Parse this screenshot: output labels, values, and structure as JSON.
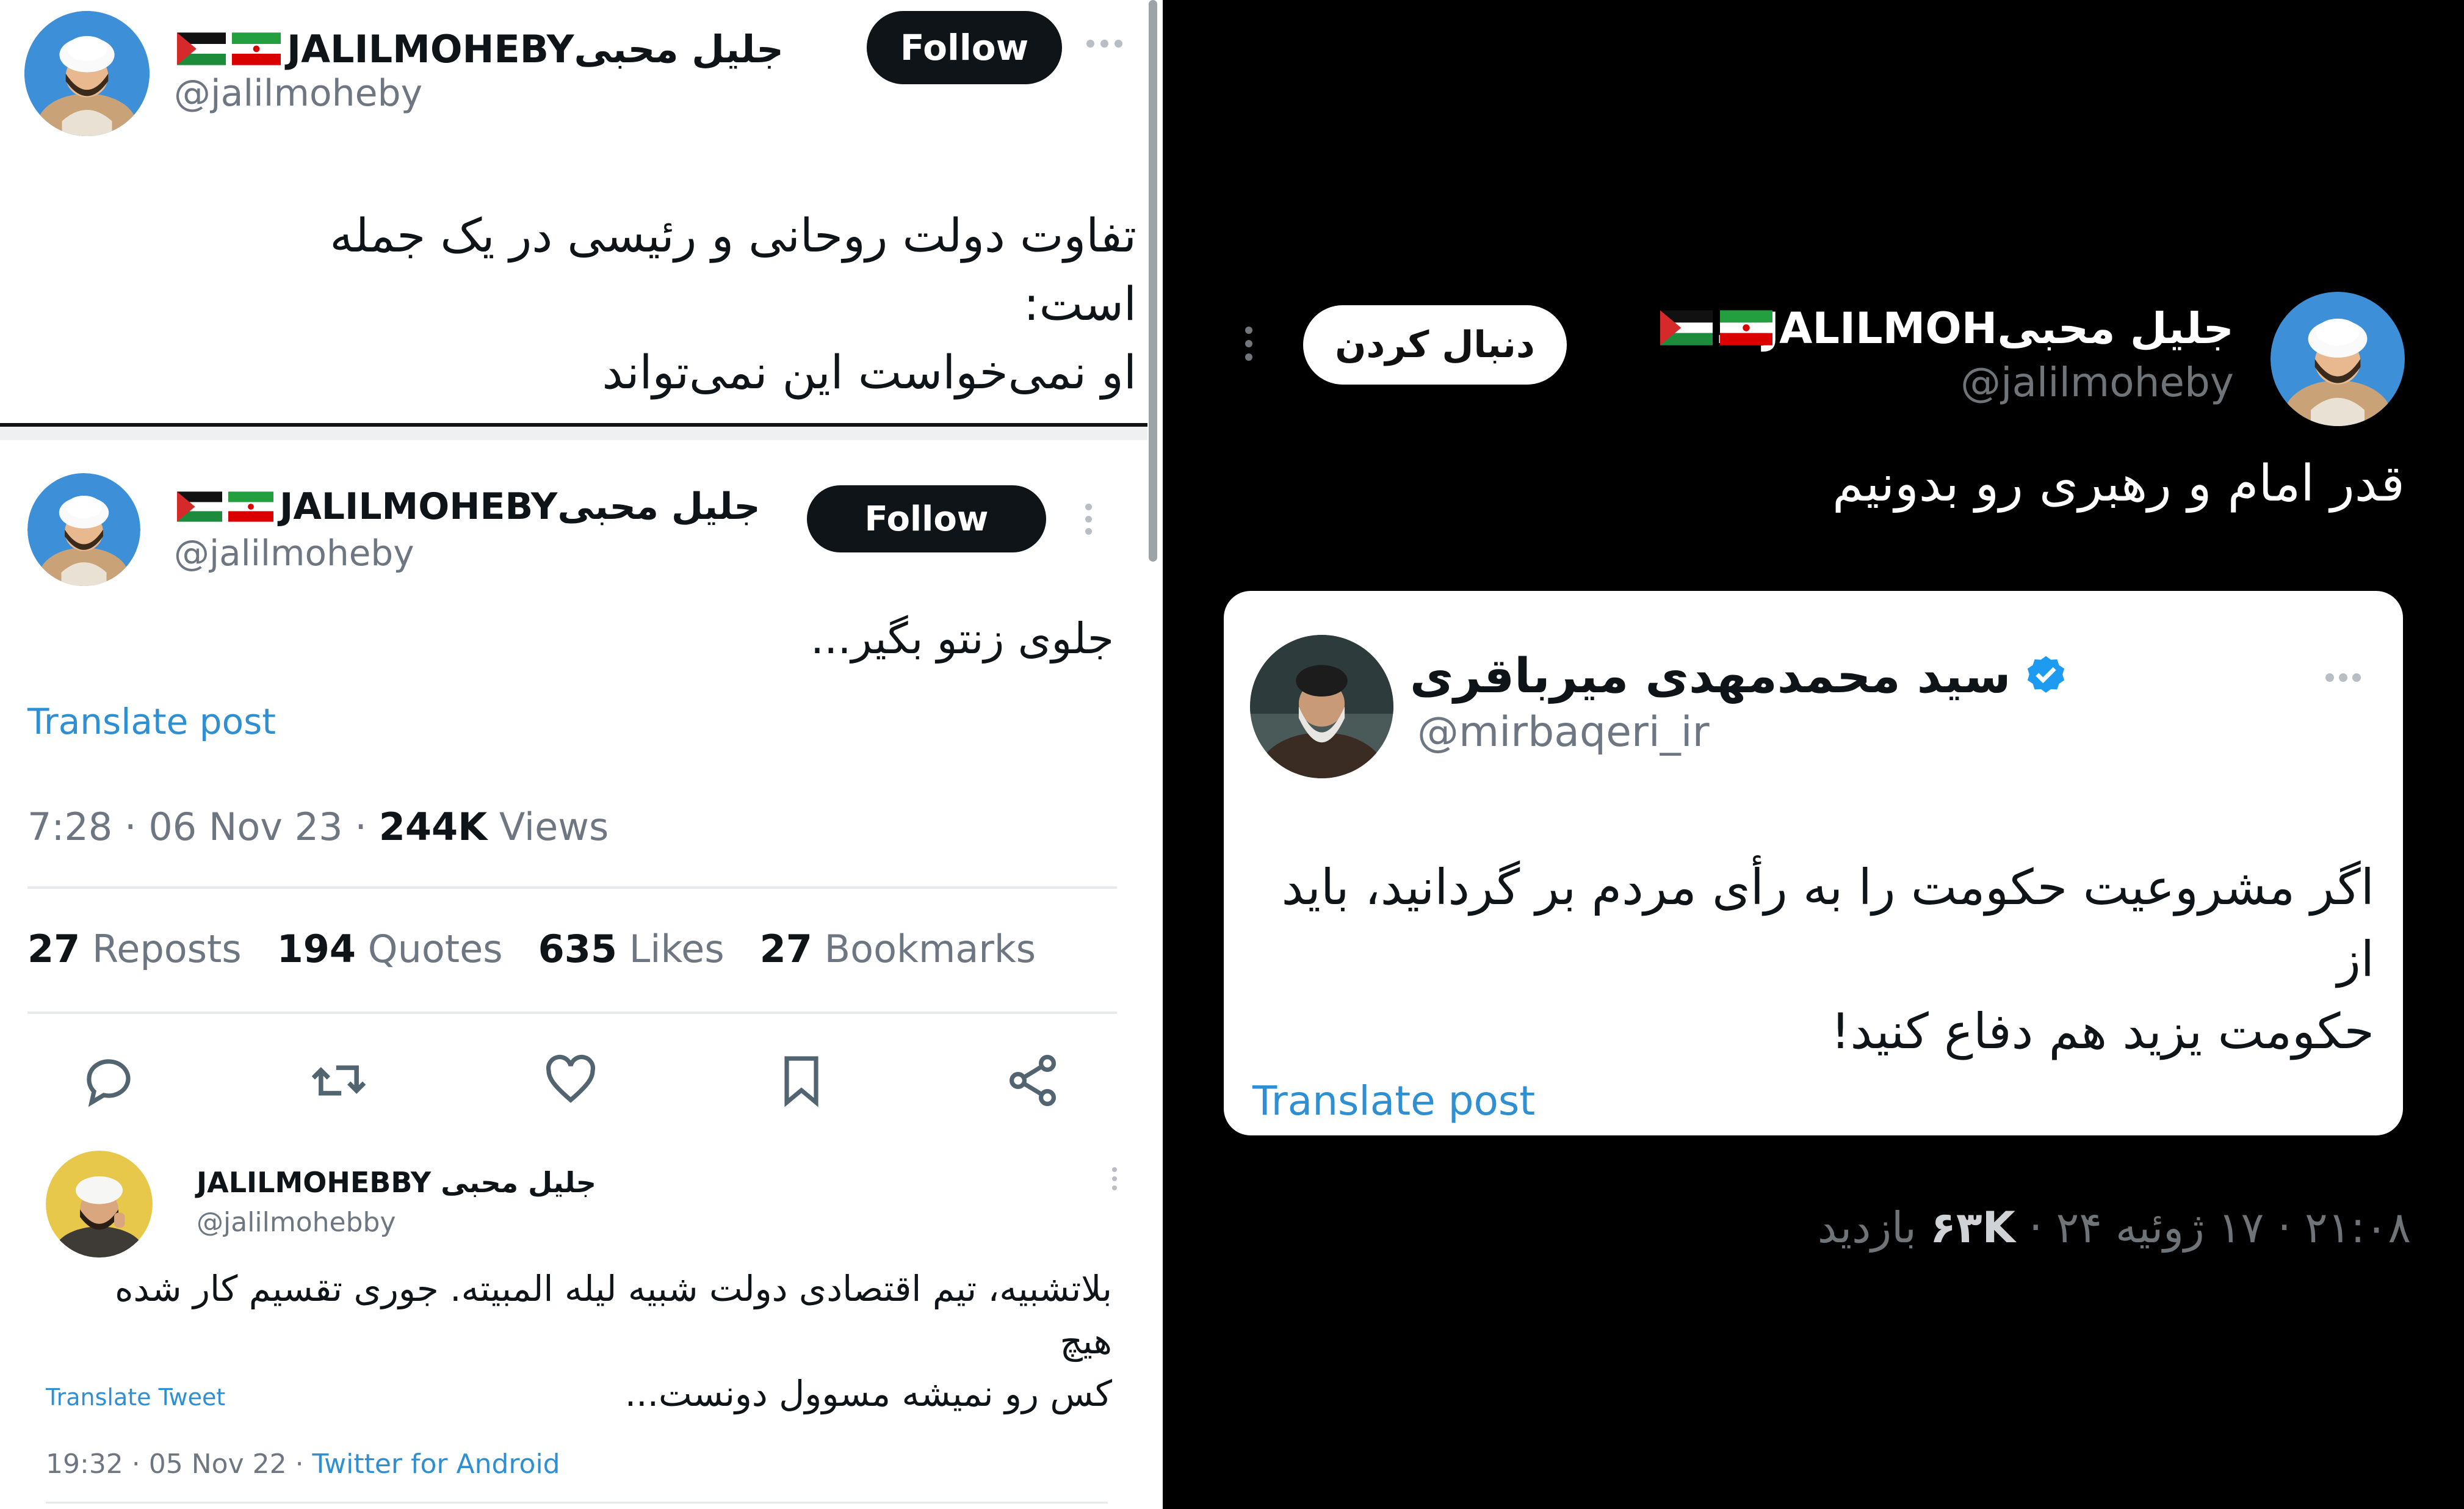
{
  "left_top": {
    "name": "JALILMOHEBYجلیل محبی",
    "handle": "@jalilmoheby",
    "follow_label": "Follow",
    "text_line1": "تفاوت دولت روحانی و رئیسی در یک جمله است:",
    "text_line2": "او نمی‌خواست این نمی‌تواند"
  },
  "left_mid": {
    "name": "JALILMOHEBYجلیل محبی",
    "handle": "@jalilmoheby",
    "follow_label": "Follow",
    "text": "جلوی زنتو بگیر...",
    "translate": "Translate post",
    "time": "7:28 · 06 Nov 23 · ",
    "views_count": "244K",
    "views_label": " Views",
    "stats": [
      {
        "count": "27",
        "label": "Reposts"
      },
      {
        "count": "194",
        "label": "Quotes"
      },
      {
        "count": "635",
        "label": "Likes"
      },
      {
        "count": "27",
        "label": "Bookmarks"
      }
    ],
    "icons": [
      "reply-icon",
      "repost-icon",
      "like-icon",
      "bookmark-icon",
      "share-icon"
    ]
  },
  "left_bottom": {
    "name": "JALILMOHEBBY جلیل محبی",
    "handle": "@jalilmohebby",
    "text_line1": "بلاتشبیه، تیم اقتصادی دولت شبیه لیله المبیته. جوری تقسیم کار شده هیچ",
    "text_line2": "کس رو نمیشه مسوول دونست...",
    "translate": "Translate Tweet",
    "time": "19:32 · 05 Nov 22 · ",
    "client": "Twitter for Android"
  },
  "right": {
    "name": "جلیل محبیJALILMOH...",
    "handle": "@jalilmoheby",
    "follow_label": "دنبال کردن",
    "text": "قدر امام و رهبری رو بدونیم",
    "quote": {
      "name": "سید محمدمهدی میرباقری",
      "handle": "@mirbaqeri_ir",
      "text_line1": "اگر مشروعیت حکومت را به رأی مردم بر گردانید، باید از",
      "text_line2": "حکومت یزید هم دفاع کنید!",
      "translate": "Translate post"
    },
    "meta_prefix": "۲۱:۰۸ · ۱۷ ژوئیه ۲۴ · ",
    "views_count": "۶۳K",
    "views_label": " بازدید"
  },
  "colors": {
    "twitter_blue": "#1d9bf0",
    "link_blue": "#2f8fd3",
    "dark_bg": "#000000",
    "light_bg": "#ffffff"
  }
}
